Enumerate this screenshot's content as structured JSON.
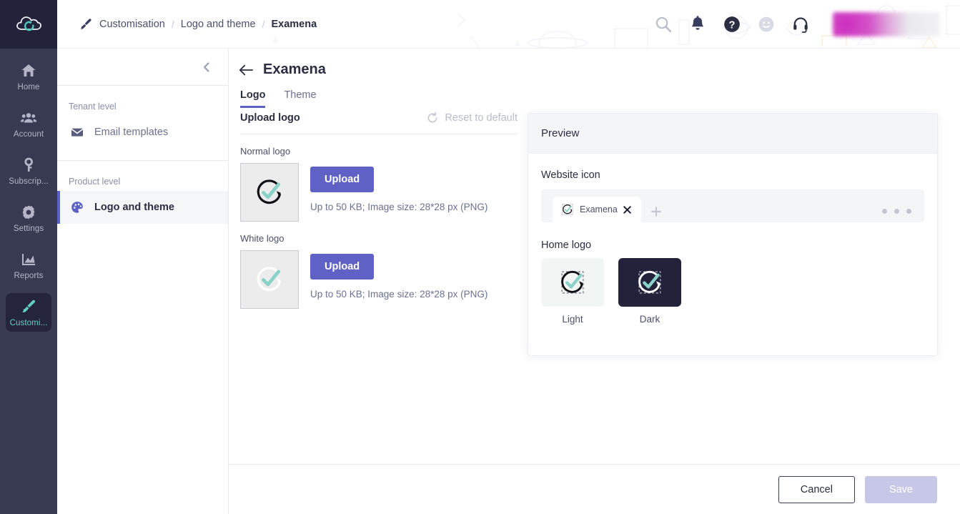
{
  "app": {
    "brand_logo_icon": "cloud-arrow-logo",
    "accent_purple": "#5f61c4",
    "accent_teal": "#63cfc2",
    "rail_bg": "#383a52"
  },
  "rail": {
    "items": [
      {
        "label": "Home",
        "icon": "home-icon",
        "active": false
      },
      {
        "label": "Account",
        "icon": "users-icon",
        "active": false
      },
      {
        "label": "Subscrip...",
        "icon": "key-icon",
        "active": false
      },
      {
        "label": "Settings",
        "icon": "gear-icon",
        "active": false
      },
      {
        "label": "Reports",
        "icon": "chart-icon",
        "active": false
      },
      {
        "label": "Customi...",
        "icon": "paintbrush-icon",
        "active": true
      }
    ]
  },
  "topbar": {
    "breadcrumb_icon": "paintbrush-icon",
    "breadcrumbs": [
      {
        "label": "Customisation",
        "current": false
      },
      {
        "label": "Logo and theme",
        "current": false
      },
      {
        "label": "Examena",
        "current": true
      }
    ],
    "separator": "/",
    "icons": [
      {
        "name": "search-icon"
      },
      {
        "name": "bell-icon"
      },
      {
        "name": "help-icon"
      },
      {
        "name": "smiley-icon"
      },
      {
        "name": "headset-icon"
      }
    ],
    "avatar": "user-avatar-blurred"
  },
  "subnav": {
    "collapse_icon": "chevron-left-icon",
    "groups": [
      {
        "label": "Tenant level",
        "items": [
          {
            "label": "Email templates",
            "icon": "envelope-icon",
            "active": false
          }
        ]
      },
      {
        "label": "Product level",
        "items": [
          {
            "label": "Logo and theme",
            "icon": "palette-icon",
            "active": true
          }
        ]
      }
    ]
  },
  "main": {
    "back_icon": "arrow-left-icon",
    "title": "Examena",
    "tabs": [
      {
        "label": "Logo",
        "active": true
      },
      {
        "label": "Theme",
        "active": false
      }
    ],
    "upload_section": {
      "title": "Upload logo",
      "reset_label": "Reset to default",
      "reset_icon": "reset-counterclockwise-icon",
      "reset_disabled": true,
      "blocks": [
        {
          "label": "Normal logo",
          "preview_icon": "examena-check-logo-dark",
          "upload_label": "Upload",
          "hint": "Up to 50 KB; Image size: 28*28 px (PNG)"
        },
        {
          "label": "White logo",
          "preview_icon": "examena-check-logo-white",
          "upload_label": "Upload",
          "hint": "Up to 50 KB; Image size: 28*28 px (PNG)"
        }
      ]
    }
  },
  "preview": {
    "title": "Preview",
    "website_icon": {
      "label": "Website icon",
      "tab_title": "Examena",
      "favicon": "examena-check-logo-dark",
      "close_icon": "close-icon",
      "new_tab_icon": "plus-icon",
      "menu_icon": "three-dots-icon"
    },
    "home_logo": {
      "label": "Home logo",
      "variants": [
        {
          "name": "Light",
          "theme": "light",
          "logo": "examena-check-logo-dark"
        },
        {
          "name": "Dark",
          "theme": "dark",
          "logo": "examena-check-logo-white"
        }
      ]
    }
  },
  "footer": {
    "cancel_label": "Cancel",
    "save_label": "Save",
    "save_disabled": true
  }
}
